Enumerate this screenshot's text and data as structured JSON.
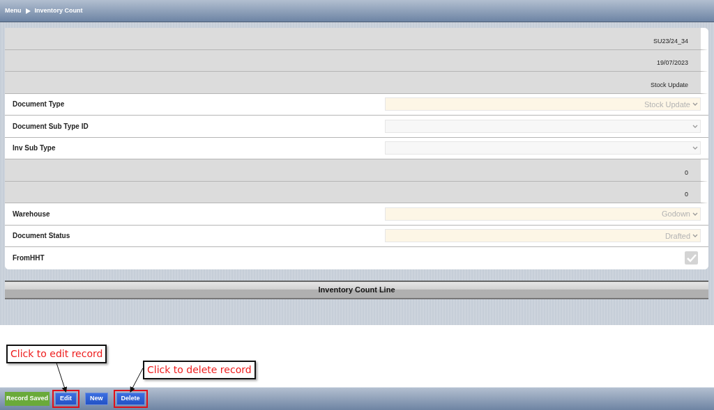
{
  "breadcrumb": {
    "menu": "Menu",
    "page": "Inventory Count"
  },
  "form": {
    "rows": [
      {
        "kind": "readonly",
        "value": "SU23/24_34"
      },
      {
        "kind": "readonly",
        "value": "19/07/2023"
      },
      {
        "kind": "readonly",
        "value": "Stock Update"
      },
      {
        "kind": "select",
        "label": "Document Type",
        "value": "Stock Update",
        "mandatory": true
      },
      {
        "kind": "select",
        "label": "Document Sub Type ID",
        "mandatory": false
      },
      {
        "kind": "select",
        "label": "Inv Sub Type",
        "mandatory": false
      },
      {
        "kind": "readonly",
        "value": "0"
      },
      {
        "kind": "readonly",
        "value": "0"
      },
      {
        "kind": "select",
        "label": "Warehouse",
        "value": "Godown",
        "mandatory": true
      },
      {
        "kind": "select",
        "label": "Document Status",
        "value": "Drafted",
        "mandatory": true
      },
      {
        "kind": "checkbox",
        "label": "FromHHT",
        "checked": true,
        "disabled": true
      }
    ]
  },
  "section": {
    "title": "Inventory Count Line"
  },
  "footer": {
    "status": "Record Saved",
    "buttons": [
      {
        "label": "Edit",
        "highlighted": true
      },
      {
        "label": "New",
        "highlighted": false
      },
      {
        "label": "Delete",
        "highlighted": true
      }
    ]
  },
  "annotations": [
    {
      "text": "Click to edit record"
    },
    {
      "text": "Click to delete record"
    }
  ]
}
